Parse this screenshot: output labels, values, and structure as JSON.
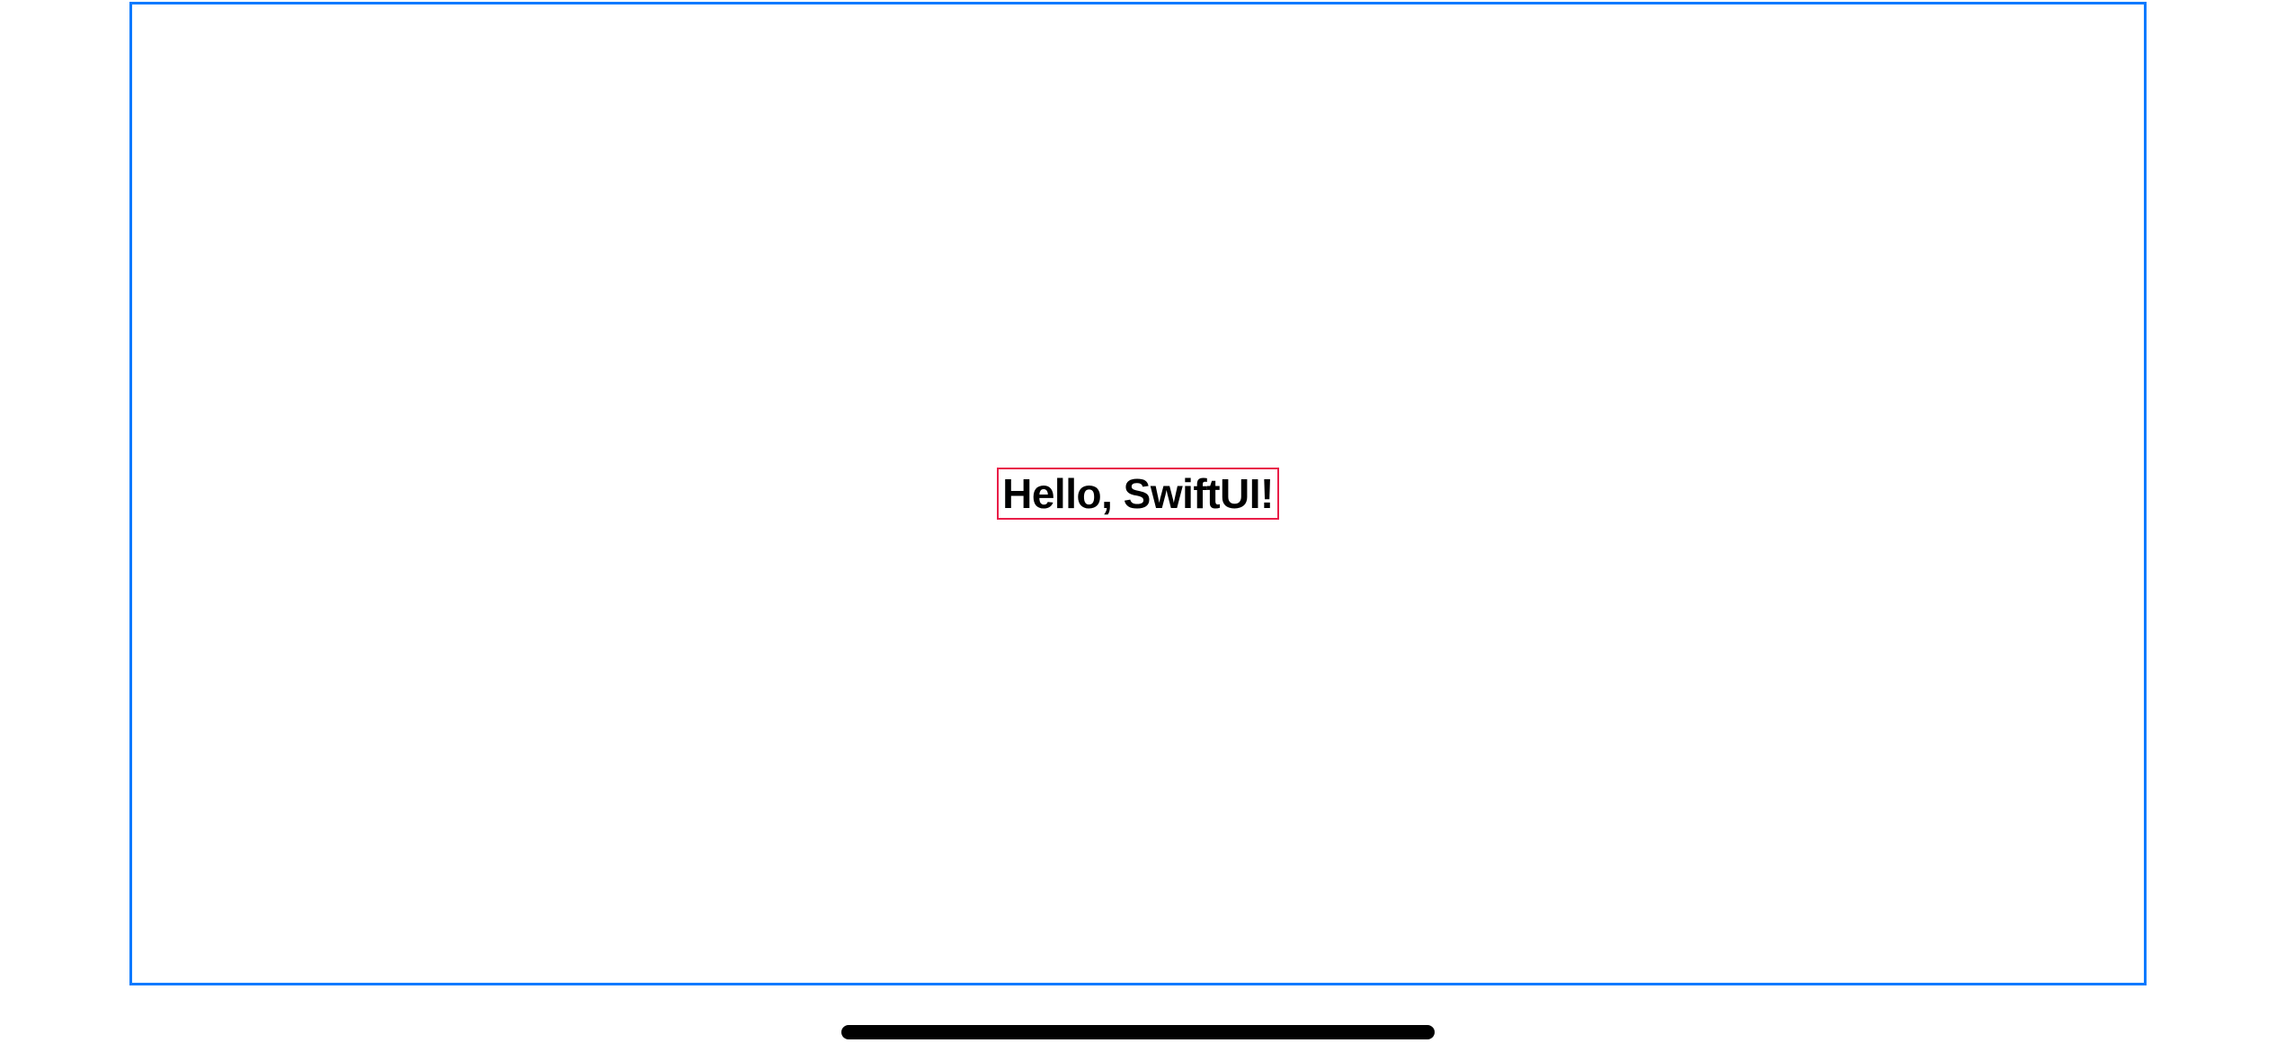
{
  "content": {
    "greeting": "Hello, SwiftUI!"
  },
  "colors": {
    "outer_border": "#0a7aff",
    "inner_border": "#e91e48",
    "text": "#000000",
    "home_indicator": "#000000"
  }
}
